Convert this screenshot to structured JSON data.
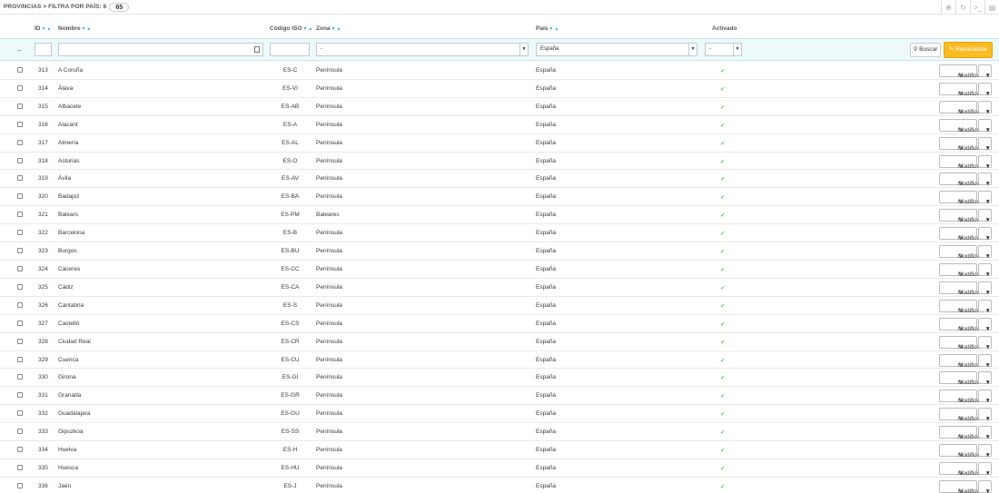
{
  "header": {
    "title": "PROVINCIAS > FILTRA POR PAÍS: 6",
    "count": "65",
    "tools": [
      "add-icon",
      "refresh-icon",
      "sql-icon",
      "export-icon"
    ]
  },
  "columns": {
    "id": "ID",
    "name": "Nombre",
    "iso": "Código ISO",
    "zone": "Zona",
    "country": "País",
    "active": "Activado"
  },
  "filters": {
    "dash": "–",
    "zone_value": "-",
    "country_value": "España",
    "active_value": "-",
    "search_label": "Buscar",
    "reset_label": "Reinicializar"
  },
  "row_actions": {
    "edit_label": "Modificar"
  },
  "accent": "#25b9d7",
  "reset_color": "#fbbb22",
  "active_color": "#72c279",
  "rows": [
    {
      "id": "313",
      "name": "A Coruña",
      "iso": "ES-C",
      "zone": "Península",
      "country": "España"
    },
    {
      "id": "314",
      "name": "Álava",
      "iso": "ES-VI",
      "zone": "Península",
      "country": "España"
    },
    {
      "id": "315",
      "name": "Albacete",
      "iso": "ES-AB",
      "zone": "Península",
      "country": "España"
    },
    {
      "id": "316",
      "name": "Alacant",
      "iso": "ES-A",
      "zone": "Península",
      "country": "España"
    },
    {
      "id": "317",
      "name": "Almería",
      "iso": "ES-AL",
      "zone": "Península",
      "country": "España"
    },
    {
      "id": "318",
      "name": "Asturias",
      "iso": "ES-O",
      "zone": "Península",
      "country": "España"
    },
    {
      "id": "319",
      "name": "Ávila",
      "iso": "ES-AV",
      "zone": "Península",
      "country": "España"
    },
    {
      "id": "320",
      "name": "Badajoz",
      "iso": "ES-BA",
      "zone": "Península",
      "country": "España"
    },
    {
      "id": "321",
      "name": "Balears",
      "iso": "ES-PM",
      "zone": "Baleares",
      "country": "España"
    },
    {
      "id": "322",
      "name": "Barcelona",
      "iso": "ES-B",
      "zone": "Península",
      "country": "España"
    },
    {
      "id": "323",
      "name": "Burgos",
      "iso": "ES-BU",
      "zone": "Península",
      "country": "España"
    },
    {
      "id": "324",
      "name": "Cáceres",
      "iso": "ES-CC",
      "zone": "Península",
      "country": "España"
    },
    {
      "id": "325",
      "name": "Cádiz",
      "iso": "ES-CA",
      "zone": "Península",
      "country": "España"
    },
    {
      "id": "326",
      "name": "Cantabria",
      "iso": "ES-S",
      "zone": "Península",
      "country": "España"
    },
    {
      "id": "327",
      "name": "Castelló",
      "iso": "ES-CS",
      "zone": "Península",
      "country": "España"
    },
    {
      "id": "328",
      "name": "Ciudad Real",
      "iso": "ES-CR",
      "zone": "Península",
      "country": "España"
    },
    {
      "id": "329",
      "name": "Cuenca",
      "iso": "ES-CU",
      "zone": "Península",
      "country": "España"
    },
    {
      "id": "330",
      "name": "Girona",
      "iso": "ES-GI",
      "zone": "Península",
      "country": "España"
    },
    {
      "id": "331",
      "name": "Granada",
      "iso": "ES-GR",
      "zone": "Península",
      "country": "España"
    },
    {
      "id": "332",
      "name": "Guadalajara",
      "iso": "ES-GU",
      "zone": "Península",
      "country": "España"
    },
    {
      "id": "333",
      "name": "Gipuzkoa",
      "iso": "ES-SS",
      "zone": "Península",
      "country": "España"
    },
    {
      "id": "334",
      "name": "Huelva",
      "iso": "ES-H",
      "zone": "Península",
      "country": "España"
    },
    {
      "id": "335",
      "name": "Huesca",
      "iso": "ES-HU",
      "zone": "Península",
      "country": "España"
    },
    {
      "id": "336",
      "name": "Jaén",
      "iso": "ES-J",
      "zone": "Península",
      "country": "España"
    }
  ]
}
